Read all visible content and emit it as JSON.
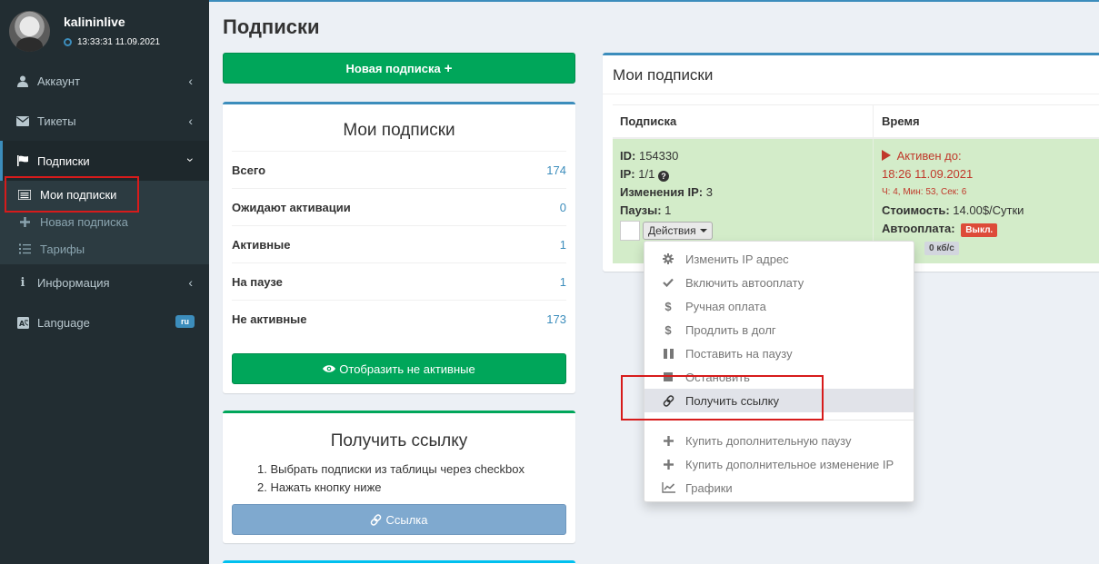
{
  "user": {
    "name": "kalininlive",
    "time": "13:33:31 11.09.2021"
  },
  "sidebar": {
    "items": [
      {
        "label": "Аккаунт",
        "icon": "user-icon"
      },
      {
        "label": "Тикеты",
        "icon": "envelope-icon"
      },
      {
        "label": "Подписки",
        "icon": "flag-icon"
      },
      {
        "label": "Информация",
        "icon": "info-icon"
      },
      {
        "label": "Language",
        "icon": "language-icon",
        "badge": "ru"
      }
    ],
    "subitems": [
      {
        "label": "Мои подписки",
        "icon": "list-icon"
      },
      {
        "label": "Новая подписка",
        "icon": "plus-icon"
      },
      {
        "label": "Тарифы",
        "icon": "list-ol-icon"
      }
    ]
  },
  "page": {
    "title": "Подписки"
  },
  "new_sub_button": "Новая подписка",
  "summary": {
    "title": "Мои подписки",
    "rows": [
      {
        "label": "Всего",
        "value": "174"
      },
      {
        "label": "Ожидают активации",
        "value": "0"
      },
      {
        "label": "Активные",
        "value": "1"
      },
      {
        "label": "На паузе",
        "value": "1"
      },
      {
        "label": "Не активные",
        "value": "173"
      }
    ],
    "show_inactive_button": "Отобразить не активные"
  },
  "get_link": {
    "title": "Получить ссылку",
    "steps": [
      "1. Выбрать подписки из таблицы через checkbox",
      "2. Нажать кнопку ниже"
    ],
    "button": "Ссылка"
  },
  "subscriptions": {
    "title": "Мои подписки",
    "columns": [
      "Подписка",
      "Время"
    ],
    "row": {
      "id_label": "ID:",
      "id": "154330",
      "ip_label": "IP:",
      "ip": "1/1",
      "ip_changes_label": "Изменения IP:",
      "ip_changes": "3",
      "pauses_label": "Паузы:",
      "pauses": "1",
      "actions_button": "Действия",
      "status": "Активен до:",
      "until": "18:26 11.09.2021",
      "remaining": "Ч: 4, Мин: 53, Сек: 6",
      "cost_label": "Стоимость:",
      "cost": "14.00$/Сутки",
      "autopay_label": "Автооплата:",
      "autopay": "Выкл.",
      "speed": "0 кб/с"
    }
  },
  "dropdown": {
    "items": [
      {
        "label": "Изменить IP адрес",
        "icon": "gear-icon"
      },
      {
        "label": "Включить автооплату",
        "icon": "check-icon"
      },
      {
        "label": "Ручная оплата",
        "icon": "dollar-icon"
      },
      {
        "label": "Продлить в долг",
        "icon": "dollar-icon"
      },
      {
        "label": "Поставить на паузу",
        "icon": "pause-icon"
      },
      {
        "label": "Остановить",
        "icon": "stop-icon"
      },
      {
        "label": "Получить ссылку",
        "icon": "link-icon"
      },
      {
        "label": "Купить дополнительную паузу",
        "icon": "plus-icon"
      },
      {
        "label": "Купить дополнительное изменение IP",
        "icon": "plus-icon"
      },
      {
        "label": "Графики",
        "icon": "line-chart-icon"
      }
    ]
  },
  "colors": {
    "sidebar": "#222d32",
    "accent": "#3c8dbc",
    "success": "#00a65a",
    "danger": "#dd4b39",
    "highlight_box": "#d71b1b"
  }
}
